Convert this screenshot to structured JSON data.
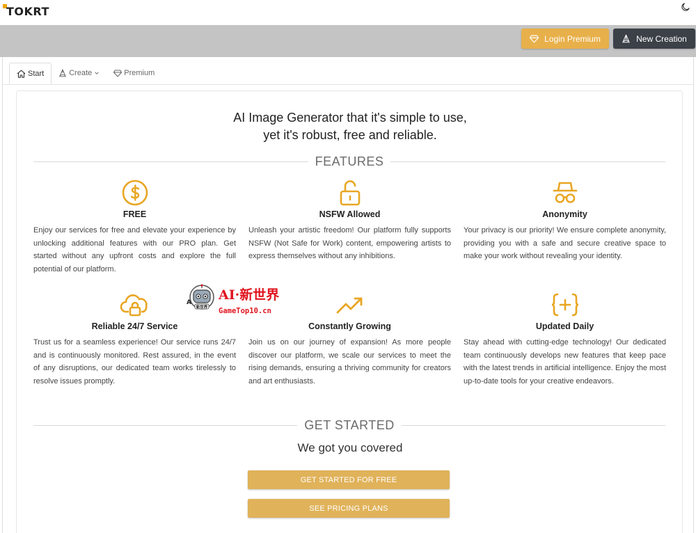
{
  "header": {
    "logo": "TOKRT",
    "theme_toggle_icon": "moon-icon"
  },
  "toolbar": {
    "login_premium_label": "Login Premium",
    "new_creation_label": "New Creation"
  },
  "tabs": [
    {
      "label": "Start",
      "icon": "home-icon",
      "active": true
    },
    {
      "label": "Create",
      "icon": "pen-nib-icon",
      "active": false
    },
    {
      "label": "Premium",
      "icon": "diamond-icon",
      "active": false
    }
  ],
  "hero": {
    "line1": "AI Image Generator that it's simple to use,",
    "line2": "yet it's robust, free and reliable."
  },
  "features_title": "FEATURES",
  "features": [
    {
      "title": "FREE",
      "icon": "dollar-circle-icon",
      "text": "Enjoy our services for free and elevate your experience by unlocking additional features with our PRO plan. Get started without any upfront costs and explore the full potential of our platform."
    },
    {
      "title": "NSFW Allowed",
      "icon": "unlock-icon",
      "text": "Unleash your artistic freedom! Our platform fully supports NSFW (Not Safe for Work) content, empowering artists to express themselves without any inhibitions."
    },
    {
      "title": "Anonymity",
      "icon": "incognito-icon",
      "text": "Your privacy is our priority! We ensure complete anonymity, providing you with a safe and secure creative space to make your work without revealing your identity."
    },
    {
      "title": "Reliable 24/7 Service",
      "icon": "cloud-lock-icon",
      "text": "Trust us for a seamless experience! Our service runs 24/7 and is continuously monitored. Rest assured, in the event of any disruptions, our dedicated team works tirelessly to resolve issues promptly."
    },
    {
      "title": "Constantly Growing",
      "icon": "trending-up-icon",
      "text": "Join us on our journey of expansion! As more people discover our platform, we scale our services to meet the rising demands, ensuring a thriving community for creators and art enthusiasts."
    },
    {
      "title": "Updated Daily",
      "icon": "braces-plus-icon",
      "text": "Stay ahead with cutting-edge technology! Our dedicated team continuously develops new features that keep pace with the latest trends in artificial intelligence. Enjoy the most up-to-date tools for your creative endeavors."
    }
  ],
  "get_started": {
    "title": "GET STARTED",
    "subtitle": "We got you covered",
    "cta_free": "GET STARTED FOR FREE",
    "cta_pricing": "SEE PRICING PLANS"
  },
  "watermark": {
    "title": "AI·新世界",
    "subtitle": "GameTop10.cn",
    "robot_badge": "新世界",
    "robot_letter": "A"
  },
  "colors": {
    "accent": "#e8a623",
    "toolbar_bg": "#c4c4c4",
    "dark_button": "#3c4148",
    "cta": "#e0b25a"
  }
}
